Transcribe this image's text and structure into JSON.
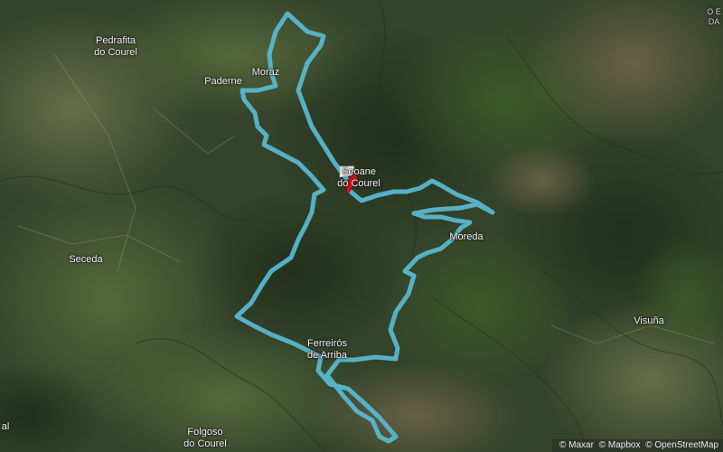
{
  "map": {
    "type": "satellite-terrain",
    "route_color": "#58b7cf",
    "start_flag_color": "#ffffff",
    "end_flag_color": "#e0101a"
  },
  "places": {
    "pedrafita": {
      "l1": "Pedrafita",
      "l2": "do Courel"
    },
    "paderne": {
      "l1": "Paderne"
    },
    "moraz": {
      "l1": "Moraz"
    },
    "seoane": {
      "l1": "Seoane",
      "l2": "do Courel"
    },
    "seceda": {
      "l1": "Seceda"
    },
    "moreda": {
      "l1": "Moreda"
    },
    "visuna": {
      "l1": "Visuña"
    },
    "ferreiros": {
      "l1": "Ferreirós",
      "l2": "de Arriba"
    },
    "folgoso": {
      "l1": "Folgoso",
      "l2": "do Courel"
    },
    "corner_ne": {
      "l1": "O E",
      "l2": "DA"
    },
    "edge_w": {
      "l1": "al"
    }
  },
  "attribution": {
    "maxar": "© Maxar",
    "mapbox": "© Mapbox",
    "osm": "© OpenStreetMap"
  }
}
